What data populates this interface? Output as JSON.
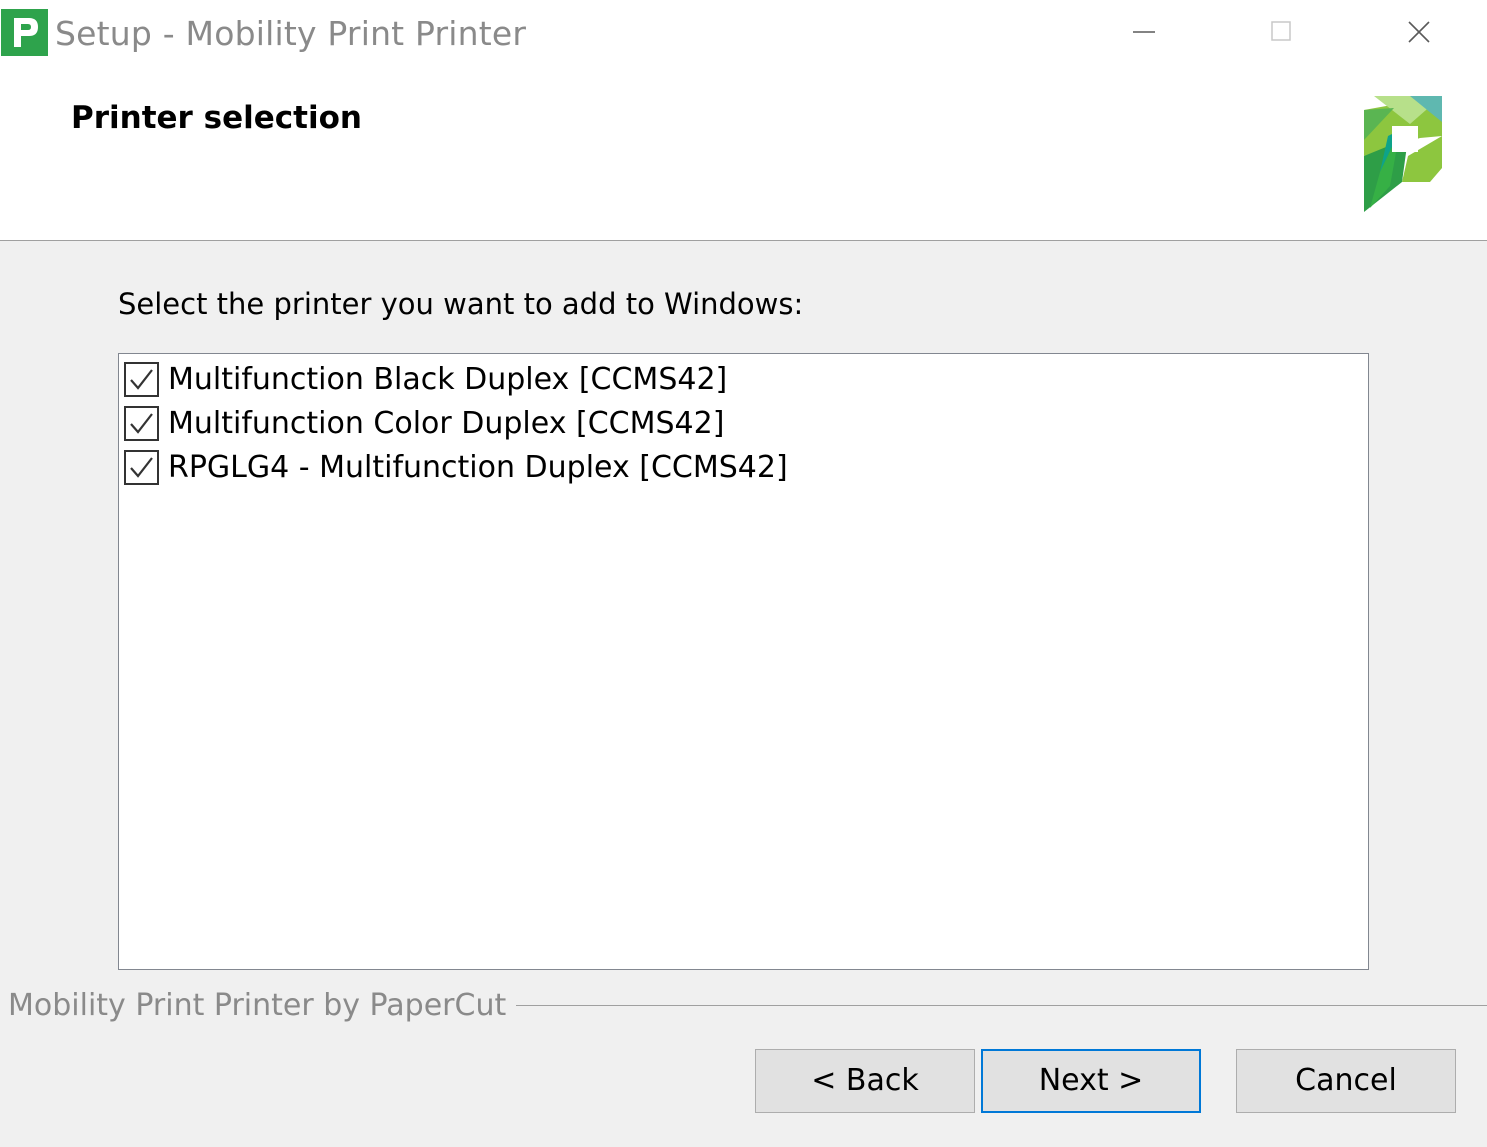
{
  "window": {
    "title": "Setup - Mobility Print Printer",
    "icon": "papercut-p-icon",
    "controls": [
      "minimize-icon",
      "maximize-icon",
      "close-icon"
    ]
  },
  "header": {
    "title": "Printer selection",
    "logo": "papercut-logo"
  },
  "body": {
    "instruction": "Select the printer you want to add to Windows:",
    "printers": [
      {
        "label": "Multifunction Black Duplex [CCMS42]",
        "checked": true
      },
      {
        "label": "Multifunction Color Duplex [CCMS42]",
        "checked": true
      },
      {
        "label": "RPGLG4 - Multifunction Duplex [CCMS42]",
        "checked": true
      }
    ]
  },
  "footer": {
    "branding": "Mobility Print Printer by PaperCut",
    "back_label": "< Back",
    "next_label": "Next >",
    "cancel_label": "Cancel"
  },
  "colors": {
    "accent_focus": "#0078d7",
    "brand_green": "#2ea34c",
    "background": "#f0f0f0"
  }
}
